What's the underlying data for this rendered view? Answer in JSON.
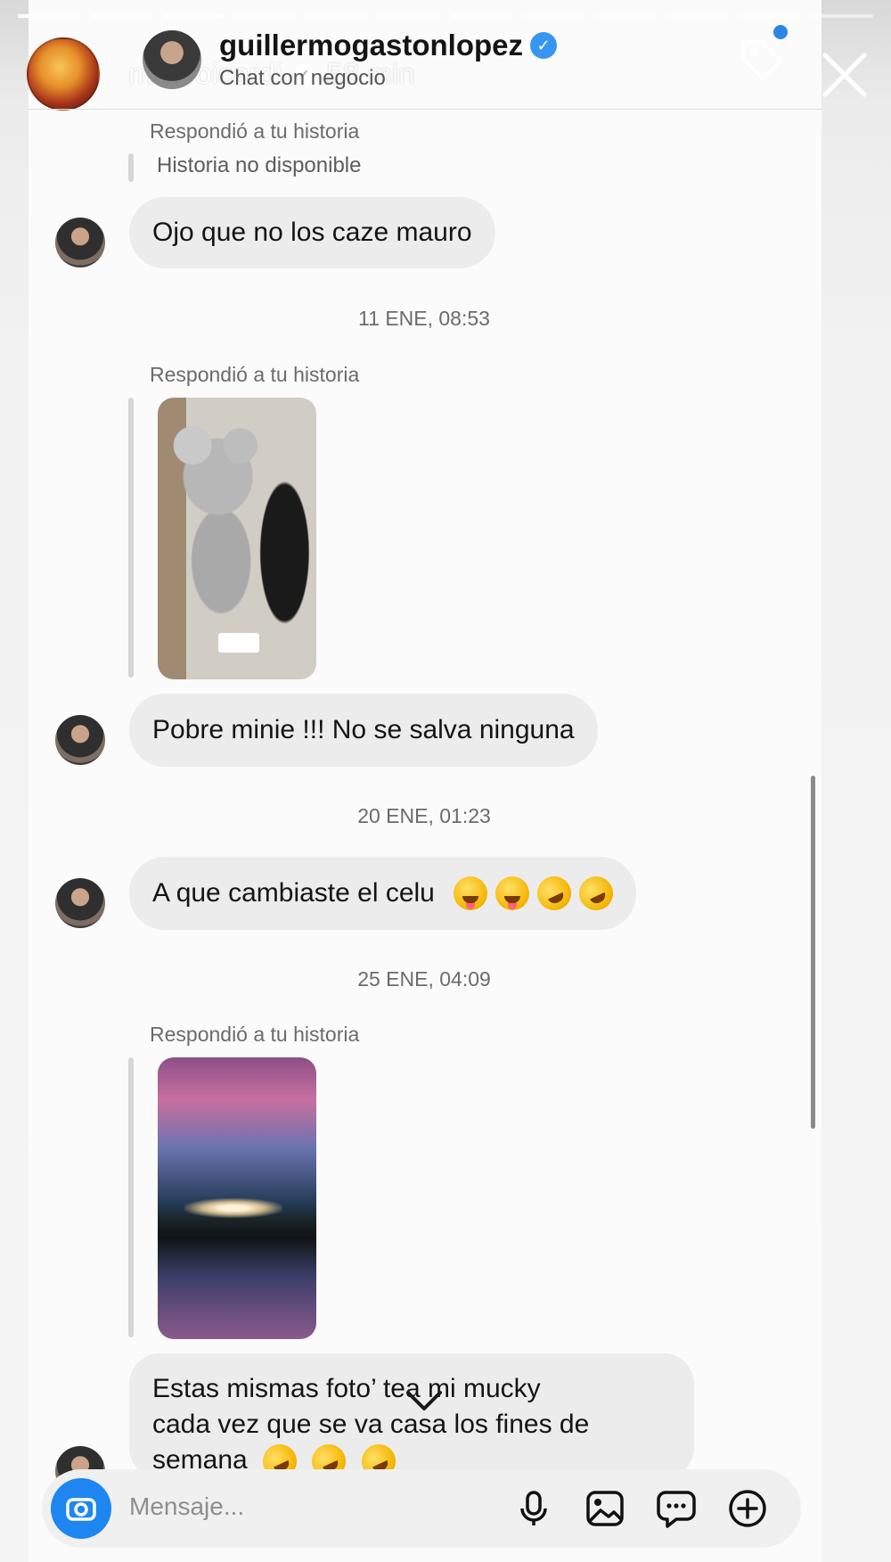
{
  "story": {
    "username": "mauroicardi",
    "time": "58 min",
    "progress_segments": 12,
    "progress_done": 7
  },
  "chat": {
    "name": "guillermogastonlopez",
    "subtitle": "Chat con negocio"
  },
  "messages": {
    "reply_label_1": "Respondió a tu historia",
    "story_unavailable": "Historia no disponible",
    "msg_1": "Ojo que no los caze mauro",
    "timestamp_1": "11 ENE, 08:53",
    "reply_label_2": "Respondió a tu historia",
    "msg_2": "Pobre minie !!! No se salva ninguna",
    "timestamp_2": "20 ENE, 01:23",
    "msg_3": "A que cambiaste el celu",
    "timestamp_3": "25 ENE, 04:09",
    "reply_label_3": "Respondió a tu historia",
    "msg_4_line_1": "Estas mismas foto’ tea mi mucky",
    "msg_4_line_2": "cada vez que se va casa los fines de",
    "msg_4_line_3": "semana"
  },
  "composer": {
    "placeholder": "Mensaje..."
  },
  "icons": {
    "camera": "camera-icon",
    "mic": "microphone-icon",
    "gallery": "gallery-icon",
    "sticker": "chat-bubble-icon",
    "add": "plus-circle-icon",
    "tag": "tag-icon",
    "close": "close-icon"
  },
  "colors": {
    "accent": "#1e86f0",
    "verified": "#3797f0",
    "bubble": "#ececec"
  }
}
